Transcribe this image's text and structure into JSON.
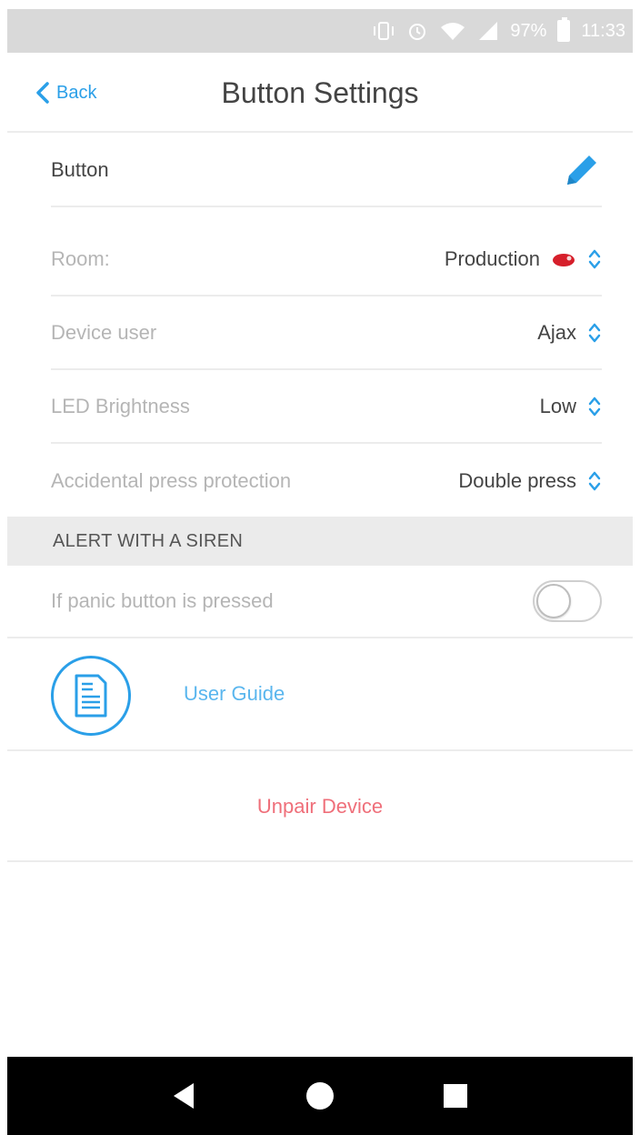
{
  "status_bar": {
    "battery": "97%",
    "time": "11:33",
    "icons": [
      "vibrate-icon",
      "alarm-icon",
      "wifi-icon",
      "signal-icon",
      "battery-icon"
    ]
  },
  "header": {
    "back_label": "Back",
    "title": "Button Settings"
  },
  "settings": {
    "name": {
      "label": "Button",
      "action_icon": "pencil-icon"
    },
    "room": {
      "label": "Room:",
      "value": "Production"
    },
    "device_user": {
      "label": "Device user",
      "value": "Ajax"
    },
    "led_brightness": {
      "label": "LED Brightness",
      "value": "Low"
    },
    "accidental_press": {
      "label": "Accidental press protection",
      "value": "Double press"
    }
  },
  "siren_section": {
    "header": "ALERT WITH A SIREN",
    "panic_label": "If panic button is pressed",
    "panic_enabled": false
  },
  "user_guide": {
    "label": "User Guide",
    "icon": "document-icon"
  },
  "unpair": {
    "label": "Unpair Device"
  },
  "colors": {
    "accent": "#2a9fe8",
    "danger": "#ef6f7a",
    "muted_text": "#b5b5b5",
    "section_bg": "#ebebeb"
  },
  "nav_bar": {
    "icons": [
      "back-triangle-icon",
      "home-circle-icon",
      "recents-square-icon"
    ]
  }
}
